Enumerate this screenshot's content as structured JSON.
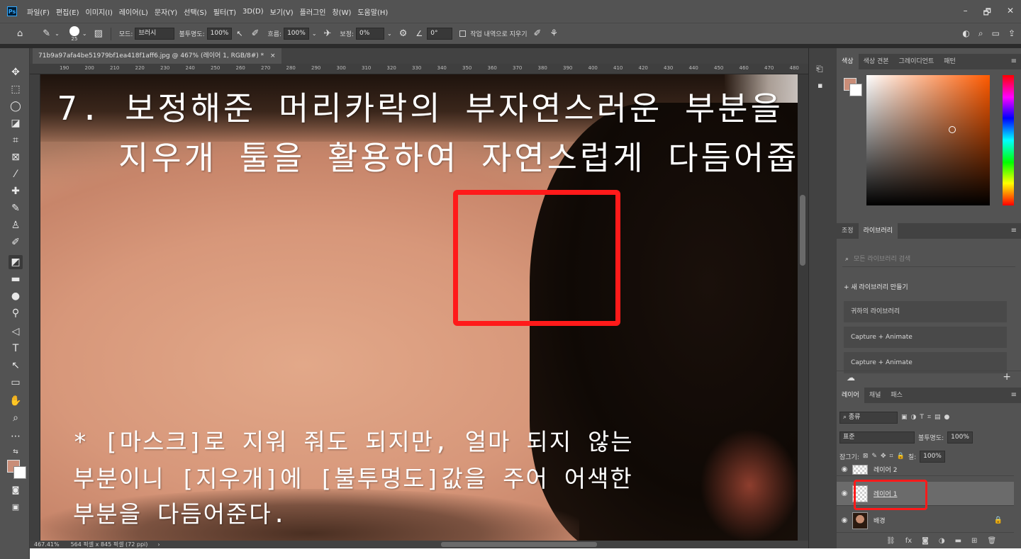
{
  "app": {
    "logo": "Ps"
  },
  "menu": [
    "파일(F)",
    "편집(E)",
    "이미지(I)",
    "레이어(L)",
    "문자(Y)",
    "선택(S)",
    "필터(T)",
    "3D(D)",
    "보기(V)",
    "플러그인",
    "창(W)",
    "도움말(H)"
  ],
  "window_controls": {
    "minimize": "–",
    "restore": "🗗",
    "close": "✕"
  },
  "options": {
    "brush_size": "25",
    "mode_label": "모드:",
    "mode_value": "브러시",
    "opacity_label": "불투명도:",
    "opacity_value": "100%",
    "flow_label": "흐름:",
    "flow_value": "100%",
    "smoothing_label": "보정:",
    "smoothing_value": "0%",
    "angle_value": "0°",
    "erase_history_label": "작업 내역으로 지우기"
  },
  "document": {
    "tab_title": "71b9a97afa4be51979bf1ea418f1aff6.jpg @ 467% (레이어 1, RGB/8#) *",
    "ruler_ticks": [
      "190",
      "200",
      "210",
      "220",
      "230",
      "240",
      "250",
      "260",
      "270",
      "280",
      "290",
      "300",
      "310",
      "320",
      "330",
      "340",
      "350",
      "360",
      "370",
      "380",
      "390",
      "400",
      "410",
      "420",
      "430",
      "440",
      "450",
      "460",
      "470",
      "480"
    ],
    "zoom": "467.41%",
    "dimensions": "564 픽셀 x 845 픽셀 (72 ppi)"
  },
  "overlay": {
    "title_line1": "7. 보정해준 머리카락의 부자연스러운 부분을",
    "title_line2": "지우개 툴을 활용하여 자연스럽게 다듬어줍니다.",
    "note_line1": "* [마스크]로 지워 줘도 되지만, 얼마 되지 않는",
    "note_line2": "부분이니 [지우개]에 [불투명도]값을 주어 어색한",
    "note_line3": "부분을 다듬어준다."
  },
  "color_panel": {
    "tabs": [
      "색상",
      "색상 견본",
      "그레이디언트",
      "패턴"
    ],
    "foreground": "#c98d78",
    "background": "#ffffff"
  },
  "library_panel": {
    "tabs": [
      "조정",
      "라이브러리"
    ],
    "search_placeholder": "모든 라이브러리 검색",
    "new_library": "+ 새 라이브러리 만들기",
    "items": [
      "귀하의 라이브러리",
      "Capture + Animate",
      "Capture + Animate"
    ]
  },
  "layers_panel": {
    "tabs": [
      "레이어",
      "채널",
      "패스"
    ],
    "filter_label": "종류",
    "blend_mode": "표준",
    "opacity_label": "불투명도:",
    "opacity_value": "100%",
    "lock_label": "잠그기:",
    "fill_label": "칠:",
    "fill_value": "100%",
    "layers": [
      {
        "name": "레이어 2"
      },
      {
        "name": "레이어 1"
      },
      {
        "name": "배경"
      }
    ]
  }
}
